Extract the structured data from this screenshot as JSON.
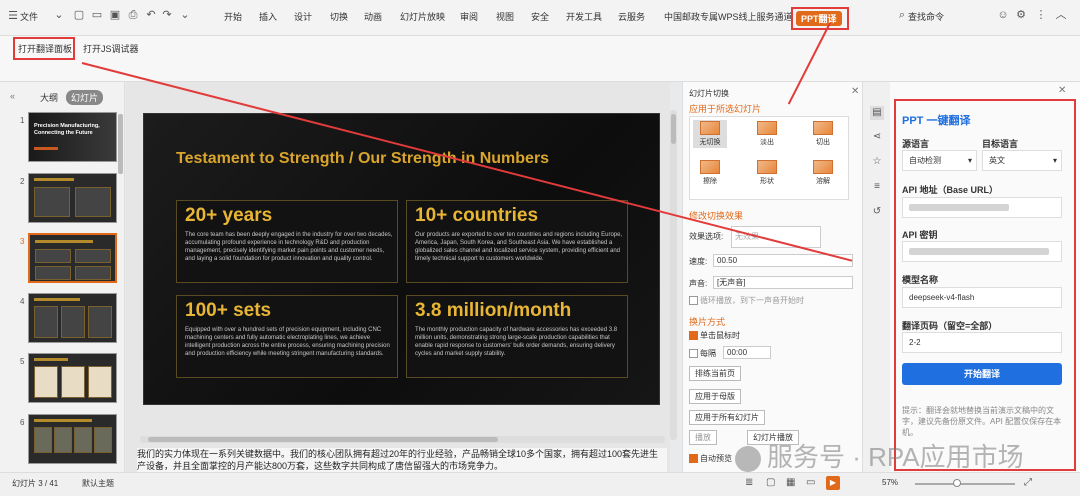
{
  "menubar": {
    "file": "文件",
    "tabs": [
      "开始",
      "插入",
      "设计",
      "切换",
      "动画",
      "幻灯片放映",
      "审阅",
      "视图",
      "安全",
      "开发工具",
      "云服务",
      "中国邮政专属WPS线上服务通道",
      "PPT翻译"
    ],
    "search": "查找命令"
  },
  "ribbon": {
    "open_translate": "打开翻译面板",
    "open_js": "打开JS调试器"
  },
  "leftpanel": {
    "tab_outline": "大纲",
    "tab_slides": "幻灯片",
    "numbers": [
      "1",
      "2",
      "3",
      "4",
      "5",
      "6"
    ],
    "thumb1_title": "Precision Manufacturing, Connecting the Future"
  },
  "slide": {
    "title": "Testament to Strength / Our Strength in Numbers",
    "cards": [
      {
        "big": "20+ years",
        "desc": "The core team has been deeply engaged in the industry for over two decades, accumulating profound experience in technology R&D and production management, precisely identifying market pain points and customer needs, and laying a solid foundation for product innovation and quality control."
      },
      {
        "big": "10+ countries",
        "desc": "Our products are exported to over ten countries and regions including Europe, America, Japan, South Korea, and Southeast Asia. We have established a globalized sales channel and localized service system, providing efficient and timely technical support to customers worldwide."
      },
      {
        "big": "100+ sets",
        "desc": "Equipped with over a hundred sets of precision equipment, including CNC machining centers and fully automatic electroplating lines, we achieve intelligent production across the entire process, ensuring machining precision and production efficiency while meeting stringent manufacturing standards."
      },
      {
        "big": "3.8 million/month",
        "desc": "The monthly production capacity of hardware accessories has exceeded 3.8 million units, demonstrating strong large-scale production capabilities that enable rapid response to customers' bulk order demands, ensuring delivery cycles and market supply stability."
      }
    ]
  },
  "notes": "我们的实力体现在一系列关键数据中。我们的核心团队拥有超过20年的行业经验，产品畅销全球10多个国家，拥有超过100套先进生产设备，并且全面掌控的月产能达800万套，这些数字共同构成了唐信留强大的市场竞争力。",
  "transition": {
    "header": "幻灯片切换",
    "apply_selected": "应用于所选幻灯片",
    "effects": [
      "无切换",
      "淡出",
      "切出",
      "擦除",
      "形状",
      "溶解"
    ],
    "modify": "修改切换效果",
    "effect_opt_label": "效果选项:",
    "effect_opt_value": "无效果",
    "speed_label": "速度:",
    "speed_value": "00.50",
    "sound_label": "声音:",
    "sound_value": "[无声音]",
    "loop": "循环播放，到下一声音开始时",
    "advance": "换片方式",
    "on_click": "单击鼠标时",
    "every": "每隔",
    "every_value": "00:00",
    "rehearse": "排练当前页",
    "apply_master": "应用于母版",
    "apply_all": "应用于所有幻灯片",
    "play": "播放",
    "slideshow": "幻灯片播放",
    "autopreview": "自动预览"
  },
  "translate": {
    "title": "PPT 一键翻译",
    "src_label": "源语言",
    "src_value": "自动检测",
    "tgt_label": "目标语言",
    "tgt_value": "英文",
    "url_label": "API 地址（Base URL）",
    "key_label": "API 密钥",
    "model_label": "模型名称",
    "model_value": "deepseek-v4-flash",
    "pages_label": "翻译页码（留空=全部）",
    "pages_value": "2-2",
    "start": "开始翻译",
    "tip": "提示：翻译会就地替换当前演示文稿中的文字，建议先备份原文件。API 配置仅保存在本机。"
  },
  "status": {
    "slide_count": "幻灯片 3 / 41",
    "theme": "默认主题",
    "zoom": "57%"
  },
  "watermark": "服务号 · RPA应用市场",
  "colors": {
    "accent": "#e06a1a",
    "annotation": "#e23b3b",
    "primary_button": "#1f6fe0",
    "slide_gold": "#e8b634"
  }
}
